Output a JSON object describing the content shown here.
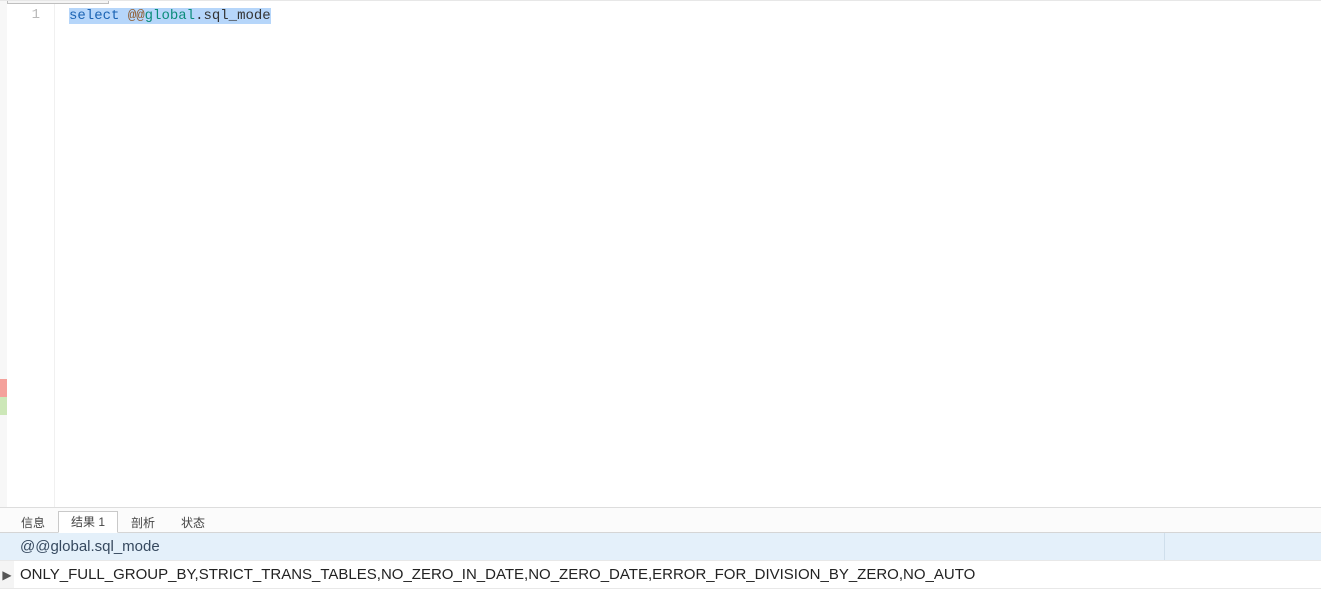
{
  "editor": {
    "line_number": "1",
    "tokens": {
      "select": "select",
      "space1": " ",
      "at": "@@",
      "global": "global",
      "dot": ".",
      "ident": "sql_mode"
    }
  },
  "result_tabs": {
    "info": "信息",
    "result1": "结果 1",
    "profile": "剖析",
    "status": "状态"
  },
  "result": {
    "column_header": "@@global.sql_mode",
    "row_marker": "▶",
    "row_value": "ONLY_FULL_GROUP_BY,STRICT_TRANS_TABLES,NO_ZERO_IN_DATE,NO_ZERO_DATE,ERROR_FOR_DIVISION_BY_ZERO,NO_AUTO"
  }
}
